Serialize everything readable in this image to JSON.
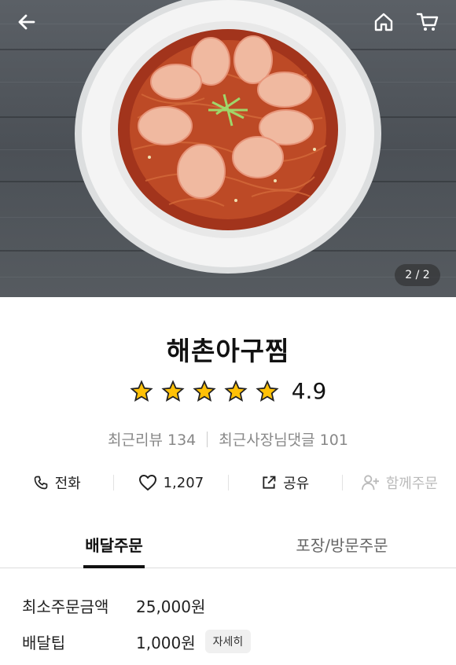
{
  "hero": {
    "pager": "2 / 2"
  },
  "store": {
    "name": "해촌아구찜",
    "rating": "4.9",
    "stars": 5,
    "recent_reviews": "최근리뷰 134",
    "owner_replies": "최근사장님댓글 101"
  },
  "actions": {
    "call": "전화",
    "like_count": "1,207",
    "share": "공유",
    "group_order": "함께주문"
  },
  "tabs": [
    "배달주문",
    "포장/방문주문"
  ],
  "info": {
    "min_order_label": "최소주문금액",
    "min_order_value": "25,000원",
    "delivery_tip_label": "배달팁",
    "delivery_tip_value": "1,000원",
    "detail_button": "자세히"
  },
  "colors": {
    "star": "#ffc107",
    "disabled": "#bbbbbb"
  }
}
